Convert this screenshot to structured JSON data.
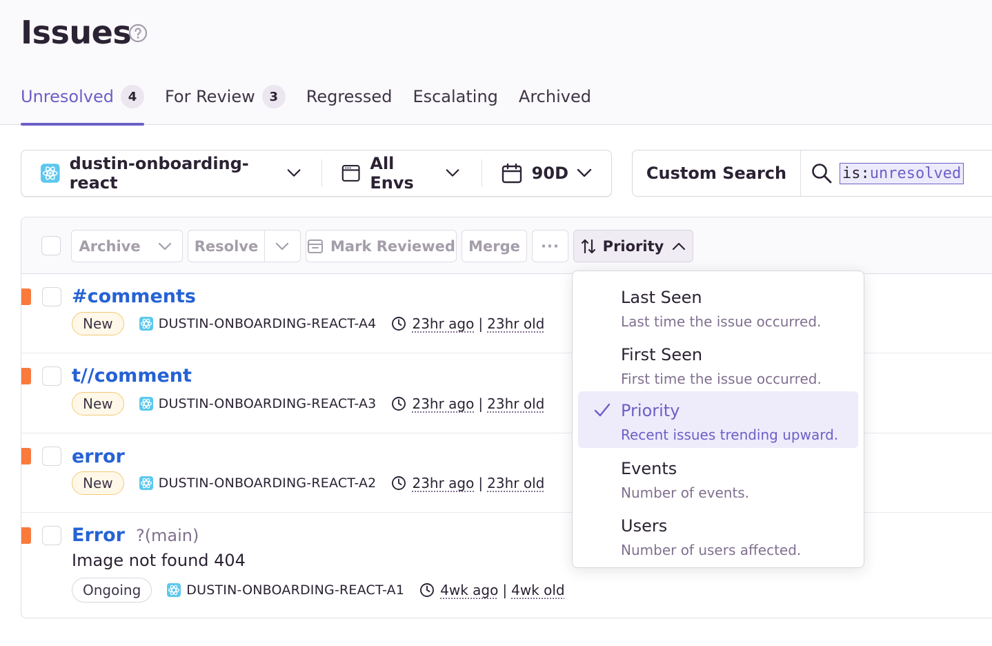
{
  "page": {
    "title": "Issues"
  },
  "tabs": [
    {
      "label": "Unresolved",
      "count": "4",
      "active": true
    },
    {
      "label": "For Review",
      "count": "3"
    },
    {
      "label": "Regressed"
    },
    {
      "label": "Escalating"
    },
    {
      "label": "Archived"
    }
  ],
  "filters": {
    "project": "dustin-onboarding-react",
    "environment": "All Envs",
    "period": "90D"
  },
  "search": {
    "custom_search_label": "Custom Search",
    "query_key": "is:",
    "query_value": "unresolved"
  },
  "toolbar": {
    "archive": "Archive",
    "resolve": "Resolve",
    "mark_reviewed": "Mark Reviewed",
    "merge": "Merge",
    "more": "···",
    "sort": "Priority"
  },
  "issues": [
    {
      "title": "#comments",
      "status": "New",
      "short_id": "DUSTIN-ONBOARDING-REACT-A4",
      "last_seen": "23hr ago",
      "first_seen": "23hr old"
    },
    {
      "title": "t//comment",
      "status": "New",
      "short_id": "DUSTIN-ONBOARDING-REACT-A3",
      "last_seen": "23hr ago",
      "first_seen": "23hr old"
    },
    {
      "title": "error",
      "status": "New",
      "short_id": "DUSTIN-ONBOARDING-REACT-A2",
      "last_seen": "23hr ago",
      "first_seen": "23hr old"
    },
    {
      "title": "Error",
      "subtitle": "?(main)",
      "message": "Image not found 404",
      "status": "Ongoing",
      "short_id": "DUSTIN-ONBOARDING-REACT-A1",
      "last_seen": "4wk ago",
      "first_seen": "4wk old"
    }
  ],
  "sort_options": [
    {
      "label": "Last Seen",
      "description": "Last time the issue occurred."
    },
    {
      "label": "First Seen",
      "description": "First time the issue occurred."
    },
    {
      "label": "Priority",
      "description": "Recent issues trending upward.",
      "selected": true
    },
    {
      "label": "Events",
      "description": "Number of events."
    },
    {
      "label": "Users",
      "description": "Number of users affected."
    }
  ],
  "colors": {
    "accent": "#6c5fc7",
    "link": "#2562d4",
    "priority_marker": "#f97a3c",
    "new_badge_border": "#f3c877"
  }
}
